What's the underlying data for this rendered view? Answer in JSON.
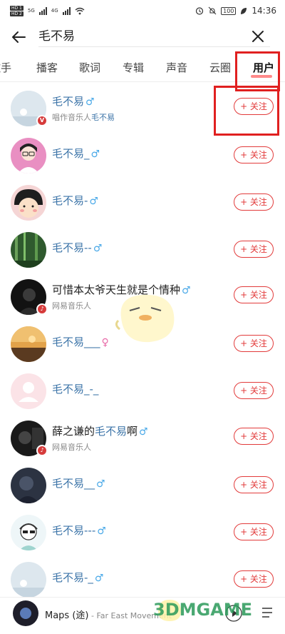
{
  "status_bar": {
    "sim1": "HD 1",
    "sim2": "HD 2",
    "network1": "5G",
    "network2": "4G",
    "battery": "100",
    "time": "14:36"
  },
  "search": {
    "query": "毛不易"
  },
  "tabs": [
    {
      "label": "歌手",
      "visible_label": "歌手"
    },
    {
      "label": "播客"
    },
    {
      "label": "歌词"
    },
    {
      "label": "专辑"
    },
    {
      "label": "声音"
    },
    {
      "label": "云圈"
    },
    {
      "label": "用户",
      "active": true
    }
  ],
  "users": [
    {
      "name": "毛不易",
      "gender": "♂",
      "subtitle_prefix": "唱作音乐人",
      "subtitle_hl": "毛不易",
      "badge": "V",
      "avatar_color": "#d9e4ec"
    },
    {
      "name": "毛不易_",
      "gender": "♂",
      "avatar_color": "#e8a0c8"
    },
    {
      "name": "毛不易-",
      "gender": "♂",
      "avatar_color": "#f4c2c2"
    },
    {
      "name": "毛不易--",
      "gender": "♂",
      "avatar_color": "#3d6b3a"
    },
    {
      "name_prefix": "可惜本太爷天生就是个情种",
      "gender": "♂",
      "subtitle_prefix": "网易音乐人",
      "badge": "♪",
      "avatar_color": "#1c1c1c"
    },
    {
      "name": "毛不易___",
      "gender": "♀",
      "avatar_color": "#c9923e"
    },
    {
      "name": "毛不易_-_",
      "gender": "",
      "avatar_color": "#f6d9de"
    },
    {
      "name_prefix": "薛之谦的",
      "name": "毛不易",
      "name_suffix": "啊",
      "gender": "♂",
      "subtitle_prefix": "网易音乐人",
      "badge": "♪",
      "avatar_color": "#2a2a2a"
    },
    {
      "name": "毛不易__",
      "gender": "♂",
      "avatar_color": "#2c3342"
    },
    {
      "name": "毛不易---",
      "gender": "♂",
      "avatar_color": "#dfeff3"
    },
    {
      "name": "毛不易-_",
      "gender": "♂",
      "avatar_color": "#d9e4ec"
    }
  ],
  "follow_label": "+ 关注",
  "player": {
    "song": "Maps (途)",
    "artist": " - Far East Movement"
  },
  "watermark": "3DMGAME",
  "colors": {
    "accent_red": "#e23b3b",
    "link_blue": "#3c74a8",
    "highlight_box": "#e02020"
  }
}
